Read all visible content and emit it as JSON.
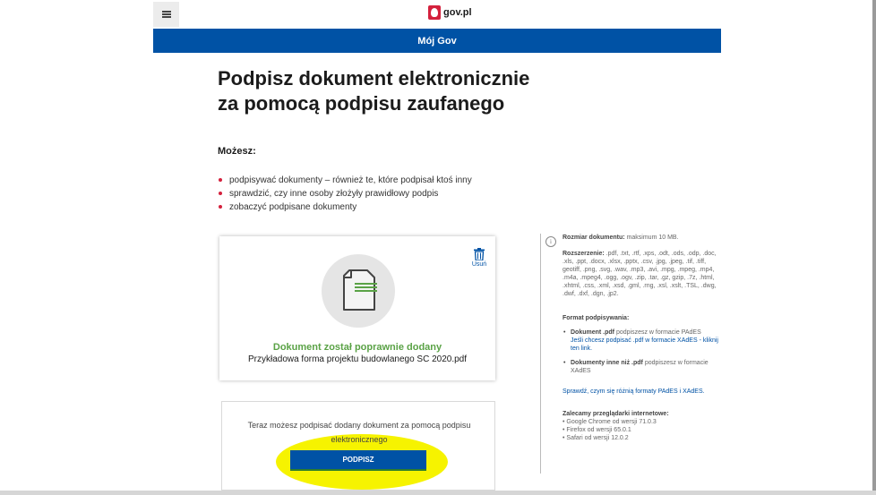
{
  "header": {
    "logo_text": "gov.pl",
    "nav_title": "Mój Gov"
  },
  "main": {
    "title_line1": "Podpisz dokument elektronicznie",
    "title_line2": "za pomocą podpisu zaufanego",
    "mozesz": "Możesz:",
    "features": [
      "podpisywać dokumenty – również te, które podpisał ktoś inny",
      "sprawdzić, czy inne osoby złożyły prawidłowy podpis",
      "zobaczyć podpisane dokumenty"
    ]
  },
  "upload": {
    "delete_label": "Usuń",
    "success_text": "Dokument został poprawnie dodany",
    "file_name": "Przykładowa forma projektu budowlanego SC 2020.pdf"
  },
  "sign": {
    "instruction": "Teraz możesz podpisać dodany dokument za pomocą podpisu elektronicznego",
    "button_label": "PODPISZ"
  },
  "sidebar": {
    "size_label": "Rozmiar dokumentu:",
    "size_value": " maksimum 10 MB.",
    "ext_label": "Rozszerzenie:",
    "ext_value": " .pdf, .txt, .rtf, .xps, .odt, .ods, .odp, .doc, .xls, .ppt, .docx, .xlsx, .pptx, .csv, .jpg, .jpeg, .tif, .tiff, geotiff, .png, .svg, .wav, .mp3, .avi, .mpg, .mpeg, .mp4, .m4a, .mpeg4, .ogg, .ogv, .zip, .tar, .gz, gzip, .7z, .html, .xhtml, .css, .xml, .xsd, .gml, .rng, .xsl, .xslt, .TSL, .dwg, .dwf, .dxf, .dgn, .jp2.",
    "format_label": "Format podpisywania:",
    "pdf_label": "Dokument .pdf",
    "pdf_text": " podpiszesz w formacie PAdES",
    "pdf_link": "Jeśli chcesz podpisać .pdf w formacie XAdES - kliknij ten link.",
    "other_label": "Dokumenty inne niż .pdf",
    "other_text": " podpiszesz w formacie XAdES",
    "compare_link": "Sprawdź, czym się różnią formaty PAdES i XAdES.",
    "browsers_label": "Zalecamy przeglądarki internetowe:",
    "browsers": [
      "• Google Chrome od wersji 71.0.3",
      "• Firefox od wersji 65.0.1",
      "• Safari od wersji 12.0.2"
    ]
  },
  "colors": {
    "brand_blue": "#0052a5",
    "success_green": "#5aa246",
    "bullet_red": "#d4213d",
    "highlight_yellow": "#f6f300"
  }
}
